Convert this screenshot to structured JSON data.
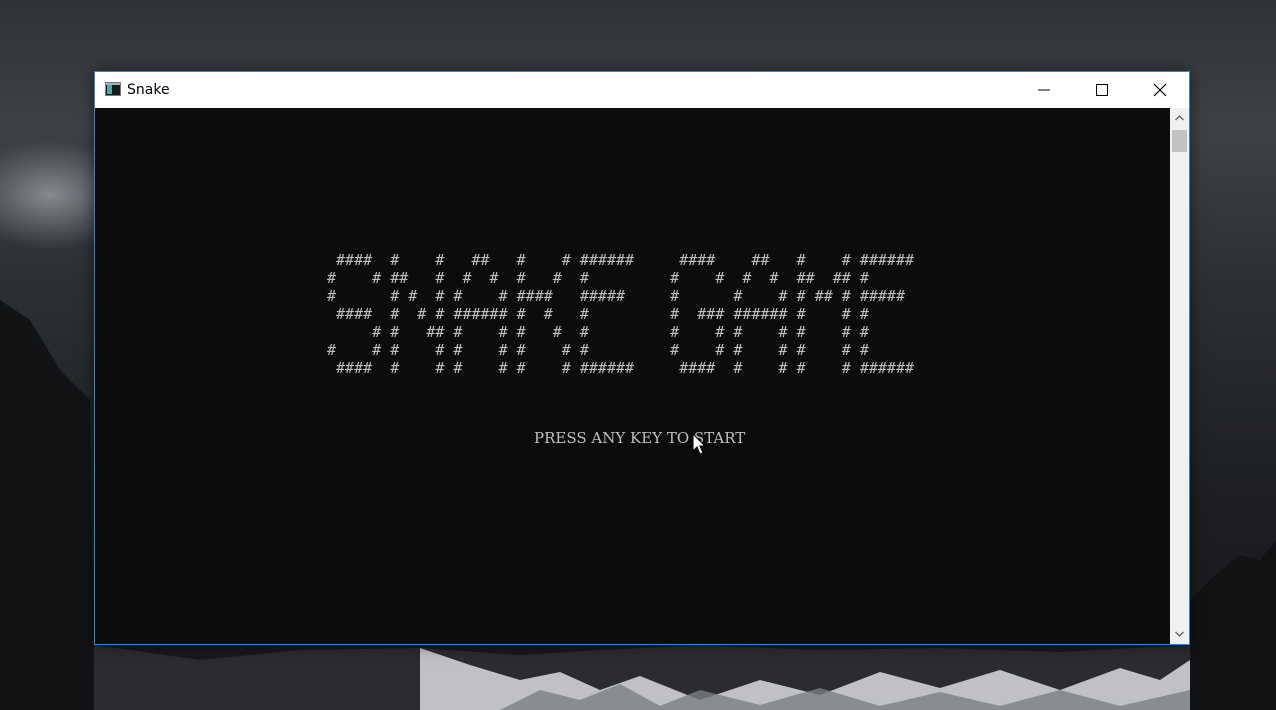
{
  "window": {
    "title": "Snake",
    "icon": "console-app-icon",
    "controls": [
      "minimize-icon",
      "maximize-icon",
      "close-icon"
    ]
  },
  "game": {
    "banner_lines": [
      " ####  #    #   ##   #    # ######     ####    ##   #    # ######",
      "#    # ##   #  #  #  #   #  #         #    #  #  #  ##  ## #",
      "#      # #  # #    # ####   #####     #      #    # # ## # #####",
      " ####  #  # # ###### #  #   #         #  ### ###### #    # #",
      "     # #   ## #    # #   #  #         #    # #    # #    # #",
      "#    # #    # #    # #    # #         #    # #    # #    # #",
      " ####  #    # #    # #    # ######     ####  #    # #    # ######"
    ],
    "prompt": "PRESS ANY KEY TO START"
  },
  "colors": {
    "console_bg": "#0c0c0c",
    "console_fg": "#c0c0c0",
    "window_border": "#3a83cf",
    "titlebar_bg": "#ffffff"
  }
}
